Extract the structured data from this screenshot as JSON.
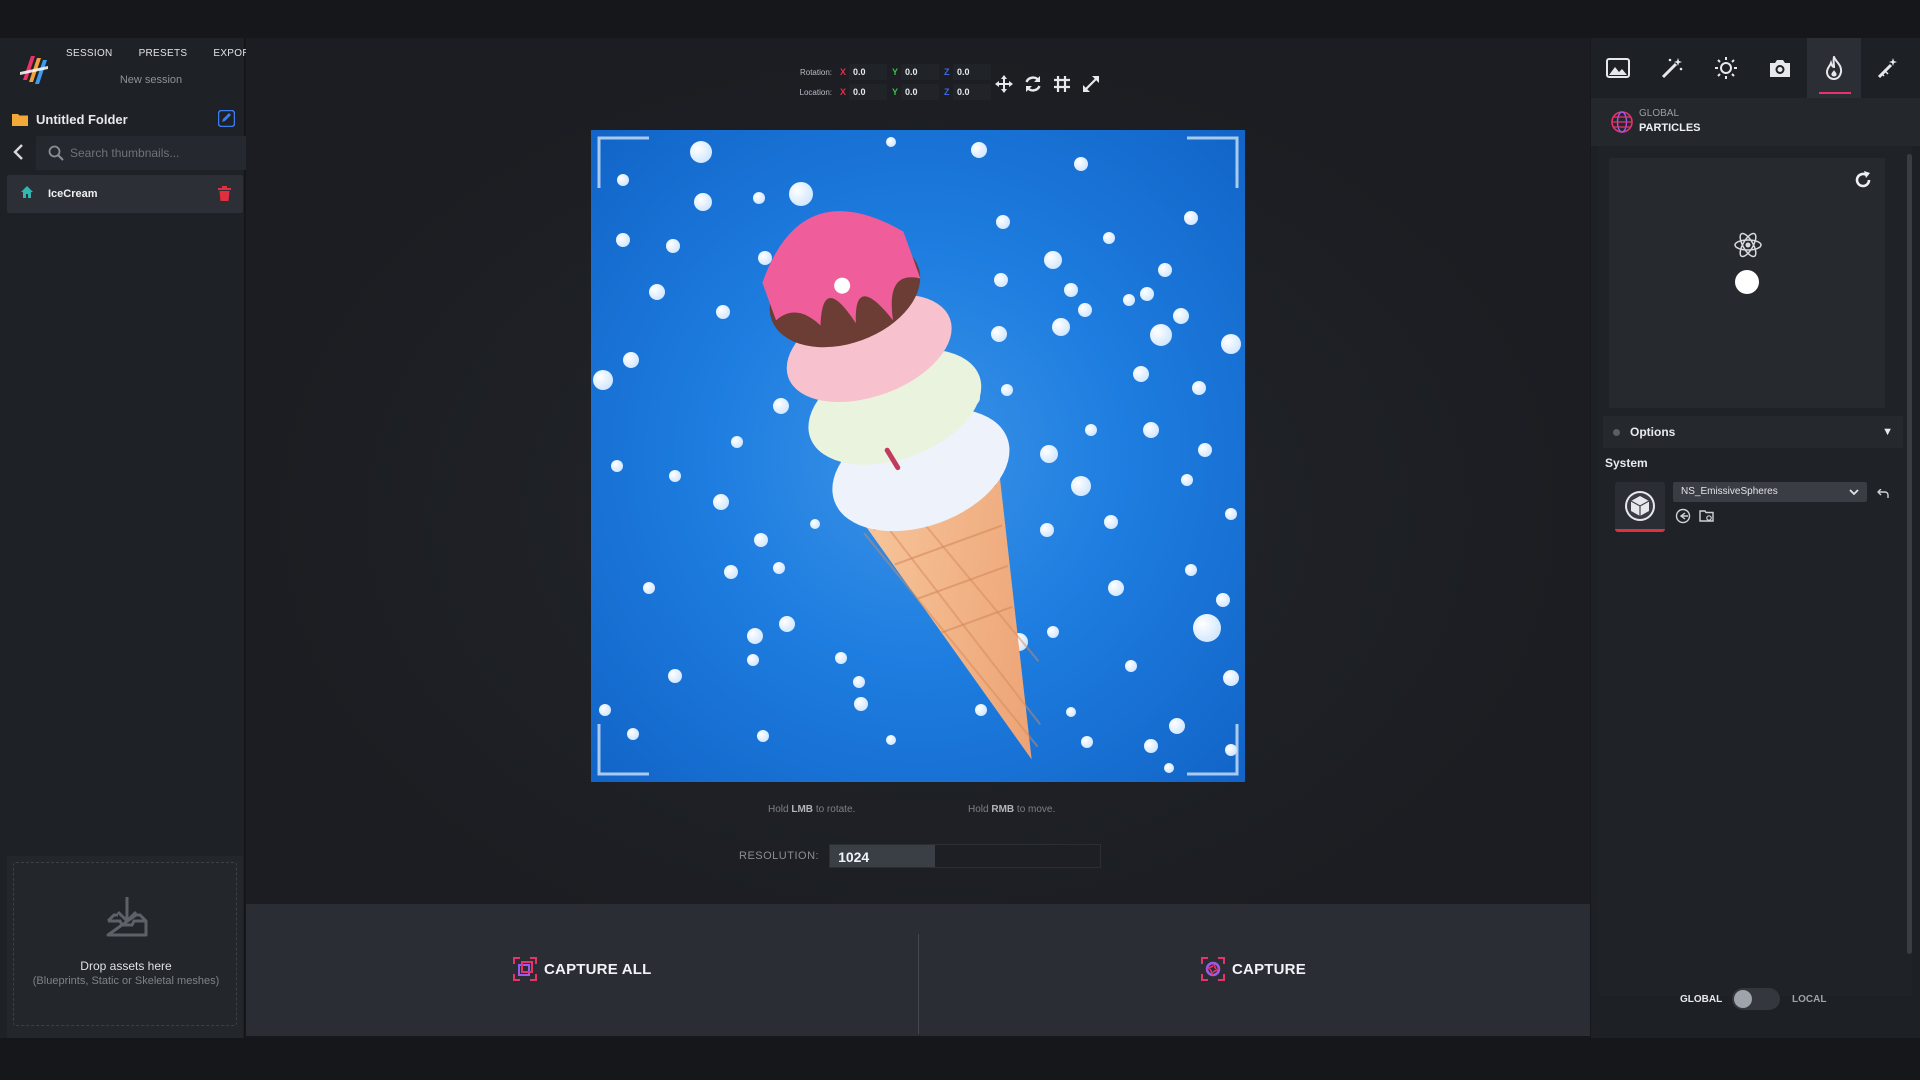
{
  "menu": {
    "session": "SESSION",
    "presets": "PRESETS",
    "export": "EXPORT"
  },
  "session_name": "New session",
  "folder": {
    "name": "Untitled Folder"
  },
  "search": {
    "placeholder": "Search thumbnails..."
  },
  "assets": [
    {
      "name": "IceCream"
    }
  ],
  "drop": {
    "title": "Drop assets here",
    "subtitle": "(Blueprints, Static or Skeletal meshes)"
  },
  "transform": {
    "rotation_label": "Rotation:",
    "location_label": "Location:",
    "axis_x": "X",
    "axis_y": "Y",
    "axis_z": "Z",
    "rotation": {
      "x": "0.0",
      "y": "0.0",
      "z": "0.0"
    },
    "location": {
      "x": "0.0",
      "y": "0.0",
      "z": "0.0"
    }
  },
  "hints": {
    "hold": "Hold",
    "lmb": "LMB",
    "lmb_action": "to rotate.",
    "rmb": "RMB",
    "rmb_action": "to move."
  },
  "resolution": {
    "label": "RESOLUTION:",
    "value": "1024",
    "fill_fraction": 0.39
  },
  "capture": {
    "all_label": "CAPTURE ALL",
    "single_label": "CAPTURE"
  },
  "right_panel": {
    "tabs": [
      "background-icon",
      "magic-wand-icon",
      "sun-icon",
      "camera-icon",
      "flame-icon",
      "wand-sparkle-icon"
    ],
    "active_tab": 4,
    "header_small": "GLOBAL",
    "header_big": "PARTICLES",
    "options_label": "Options",
    "system_label": "System",
    "system_value": "NS_EmissiveSpheres"
  },
  "toggle": {
    "left": "GLOBAL",
    "right": "LOCAL",
    "state": "GLOBAL"
  },
  "colors": {
    "accent": "#e8326a",
    "delete": "#e0303f",
    "edit": "#3d7bf0",
    "sky": "#1e7de0"
  }
}
